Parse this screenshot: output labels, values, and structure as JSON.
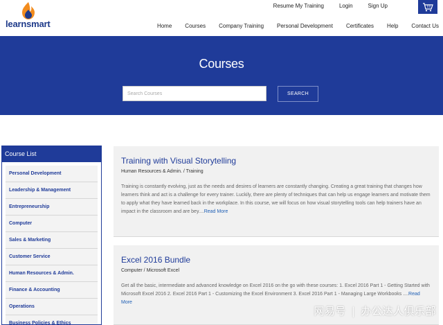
{
  "brand": {
    "name": "learnsmart",
    "color": "#1f3b99",
    "accent": "#f28c1e"
  },
  "top_links": [
    "Resume My Training",
    "Login",
    "Sign Up"
  ],
  "cart": {
    "icon": "cart-icon"
  },
  "nav": [
    "Home",
    "Courses",
    "Company Training",
    "Personal Development",
    "Certificates",
    "Help",
    "Contact Us"
  ],
  "banner": {
    "title": "Courses",
    "search_placeholder": "Search Courses",
    "search_button": "SEARCH"
  },
  "sidebar": {
    "title": "Course List",
    "items": [
      "Personal Development",
      "Leadership & Management",
      "Entrepreneurship",
      "Computer",
      "Sales & Marketing",
      "Customer Service",
      "Human Resources & Admin.",
      "Finance & Accounting",
      "Operations",
      "Business Policies & Ethics"
    ]
  },
  "courses": [
    {
      "title": "Training with Visual Storytelling",
      "category": "Human Resources & Admin. / Training",
      "description": "Training is constantly evolving, just as the needs and desires of learners are constantly changing. Creating a great training that changes how learners think and act is a challenge for every trainer. Luckily, there are plenty of techniques that can help us engage learners and motivate them to apply what they have learned back in the workplace. In this course, we will focus on how visual storytelling tools can help trainers have an impact in the classroom and are bey....",
      "more": "Read More"
    },
    {
      "title": "Excel 2016 Bundle",
      "category": "Computer / Microsoft Excel",
      "description": "Get all the basic, intermediate and advanced knowledge on Excel 2016 on the go with these courses: 1. Excel 2016 Part 1 - Getting Started with Microsoft Excel 2016 2. Excel 2016 Part 1 - Customizing the Excel Environment 3. Excel 2016 Part 1 - Managing Large Workbooks ....",
      "more": "Read More"
    }
  ],
  "watermark": {
    "left": "网易号",
    "sep": "|",
    "right": "办公达人俱乐部"
  }
}
